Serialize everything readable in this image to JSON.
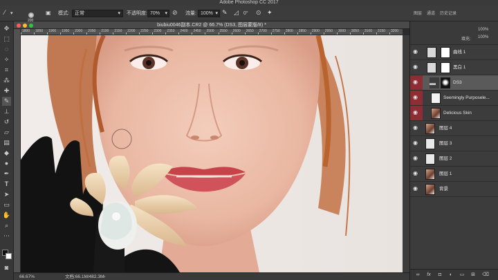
{
  "app": {
    "title": "Adobe Photoshop CC 2017"
  },
  "options": {
    "brush_size": "200",
    "mode_label": "模式:",
    "mode_value": "正常",
    "opacity_label": "不透明度:",
    "opacity_value": "70%",
    "flow_label": "流量:",
    "flow_value": "100%",
    "angle_value": "0°"
  },
  "panel_tabs": [
    "图层",
    "通道",
    "历史记录"
  ],
  "document": {
    "tab_title": "biubiu0046副本.CR2 @ 66.7% (DS3, 图层蒙版/8) *",
    "zoom": "66.67%",
    "doc_info": "文档:66.1M/482.3M"
  },
  "ruler_ticks": [
    "1800",
    "1850",
    "1900",
    "1950",
    "2000",
    "2050",
    "2100",
    "2150",
    "2200",
    "2250",
    "2300",
    "2350",
    "2400",
    "2450",
    "2500",
    "2550",
    "2600",
    "2650",
    "2700",
    "2750",
    "2800",
    "2850",
    "2900",
    "2950",
    "3000",
    "3050",
    "3100",
    "3150",
    "3200"
  ],
  "layers_panel": {
    "fill_label": "填充:",
    "fill_value": "100%",
    "opacity_value": "100%",
    "items": [
      {
        "name": "曲线 1"
      },
      {
        "name": "黑白 1"
      },
      {
        "name": "DS3"
      },
      {
        "name": "Seemingly Purposele..."
      },
      {
        "name": "Delicious Skin"
      },
      {
        "name": "图层 4"
      },
      {
        "name": "图层 3"
      },
      {
        "name": "图层 2"
      },
      {
        "name": "图层 1"
      },
      {
        "name": "背景"
      }
    ]
  },
  "footer_icons": [
    "link-icon",
    "fx-icon",
    "mask-icon",
    "adjustment-icon",
    "folder-icon",
    "new-layer-icon",
    "trash-icon"
  ],
  "colors": {
    "accent_red": "#8e2d33",
    "selected": "#5a5a5a"
  }
}
